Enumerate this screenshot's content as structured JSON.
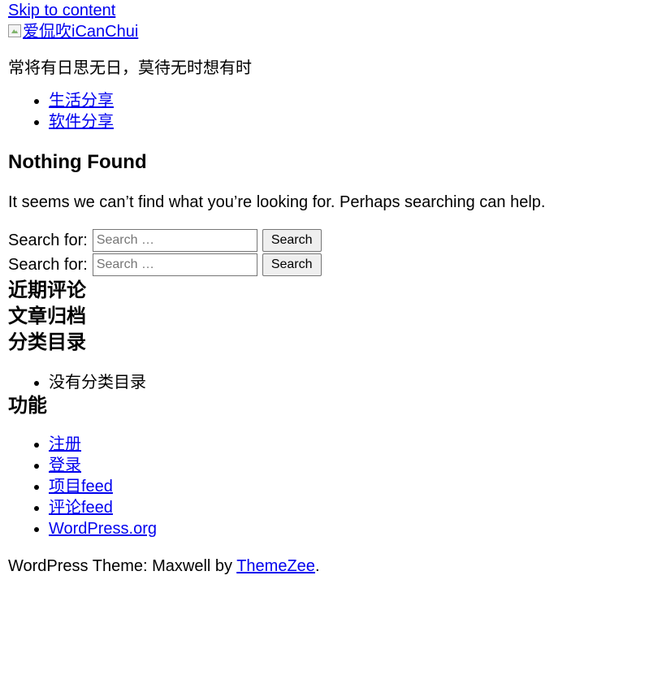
{
  "skip_link": "Skip to content",
  "site": {
    "logo_alt": "爱侃吹iCanChui",
    "tagline": "常将有日思无日，莫待无时想有时"
  },
  "nav": {
    "items": [
      {
        "label": "生活分享"
      },
      {
        "label": "软件分享"
      }
    ]
  },
  "main": {
    "title": "Nothing Found",
    "text": "It seems we can’t find what you’re looking for. Perhaps searching can help."
  },
  "search_forms": [
    {
      "label": "Search for:",
      "placeholder": "Search …",
      "button": "Search"
    },
    {
      "label": "Search for:",
      "placeholder": "Search …",
      "button": "Search"
    }
  ],
  "widgets": {
    "recent_comments_title": "近期评论",
    "archives_title": "文章归档",
    "categories_title": "分类目录",
    "categories_empty": "没有分类目录",
    "meta_title": "功能",
    "meta_links": [
      {
        "label": "注册"
      },
      {
        "label": "登录"
      },
      {
        "label": "项目feed"
      },
      {
        "label": "评论feed"
      },
      {
        "label": "WordPress.org"
      }
    ]
  },
  "footer": {
    "text": "WordPress Theme: Maxwell by",
    "link": "ThemeZee",
    "period": "."
  }
}
